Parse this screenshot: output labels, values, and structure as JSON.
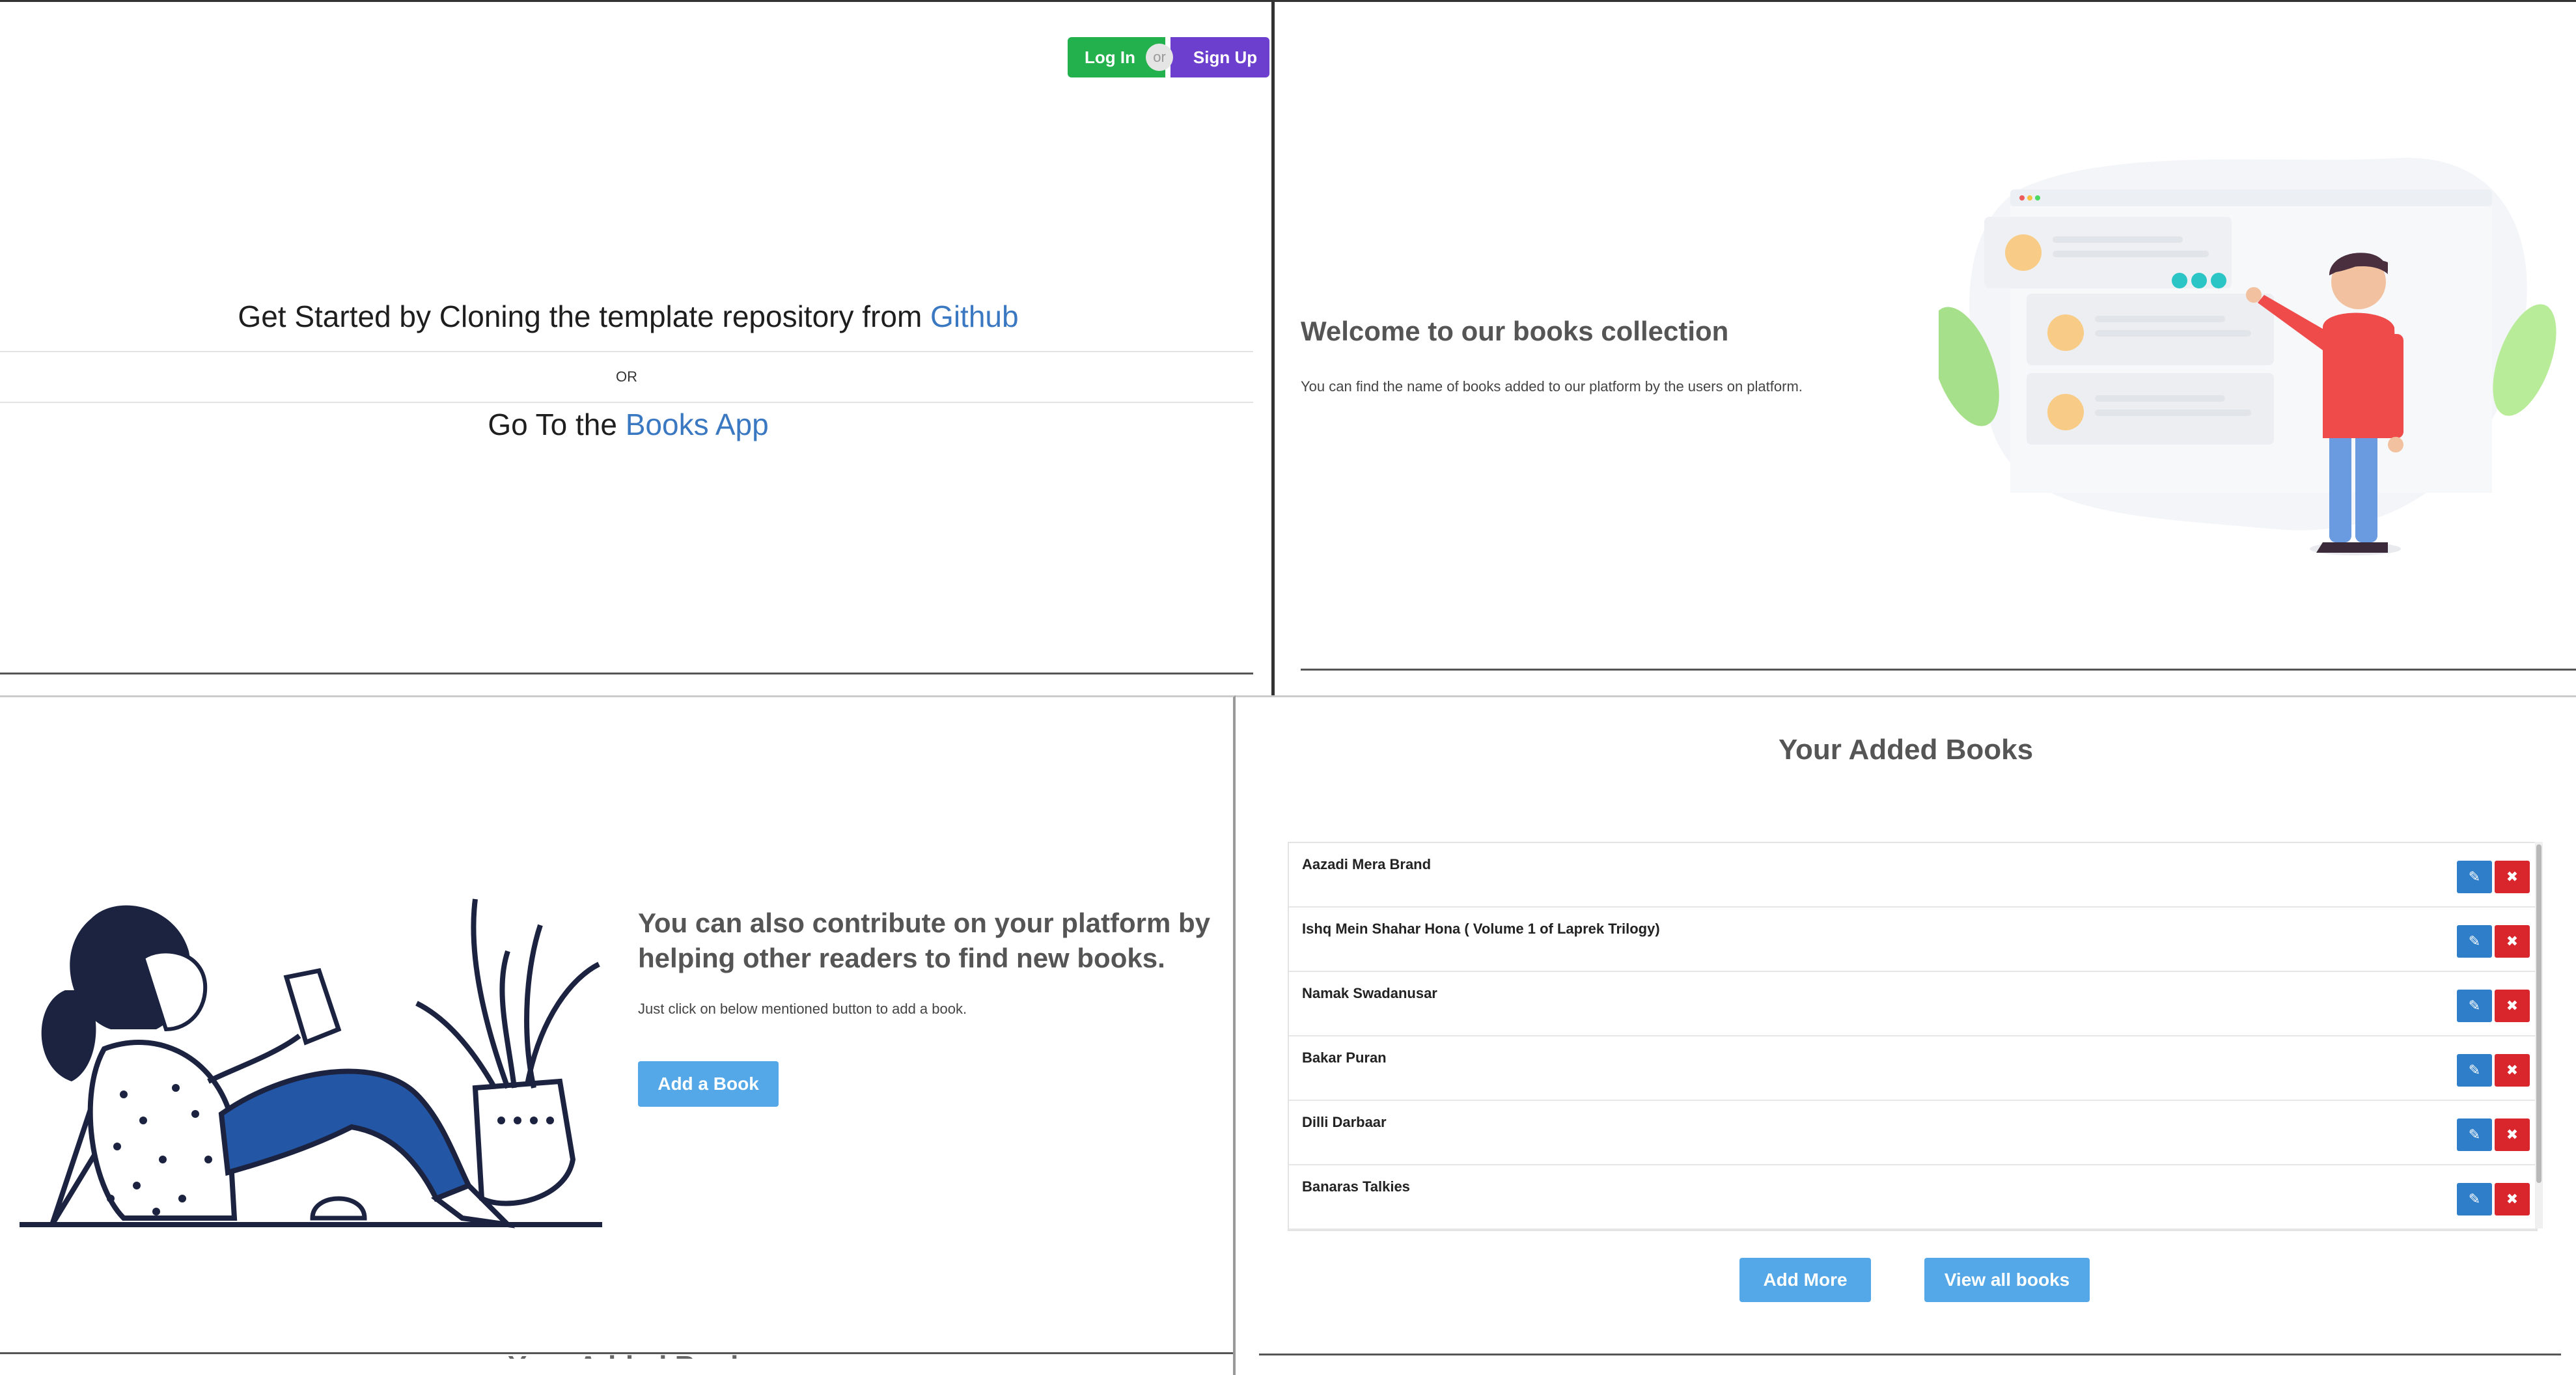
{
  "landing": {
    "login_label": "Log In",
    "or_badge": "or",
    "signup_label": "Sign Up",
    "get_started_prefix": "Get Started by Cloning the template repository from",
    "github_link": "Github",
    "or_divider": "OR",
    "go_to_prefix": "Go To the",
    "books_app_link": "Books App"
  },
  "welcome": {
    "title": "Welcome to our books collection",
    "text": "You can find the name of books added to our platform by the users on platform."
  },
  "contribute": {
    "title": "You can also contribute on your platform by helping other readers to find new books.",
    "text": "Just click on below mentioned button to add a book.",
    "add_book_label": "Add a Book",
    "next_heading_cut": "Your Added Books"
  },
  "books": {
    "title": "Your Added Books",
    "items": [
      {
        "name": "Aazadi Mera Brand"
      },
      {
        "name": "Ishq Mein Shahar Hona ( Volume 1 of Laprek Trilogy)"
      },
      {
        "name": "Namak Swadanusar"
      },
      {
        "name": "Bakar Puran"
      },
      {
        "name": "Dilli Darbaar"
      },
      {
        "name": "Banaras Talkies"
      }
    ],
    "edit_icon": "edit-icon",
    "delete_icon": "close-icon",
    "add_more_label": "Add More",
    "view_all_label": "View all books"
  },
  "colors": {
    "login": "#22b14c",
    "signup": "#6c3fcf",
    "link": "#3a78c2",
    "primary_button": "#55a8e8",
    "edit": "#2f7ec9",
    "delete": "#d9262c"
  }
}
